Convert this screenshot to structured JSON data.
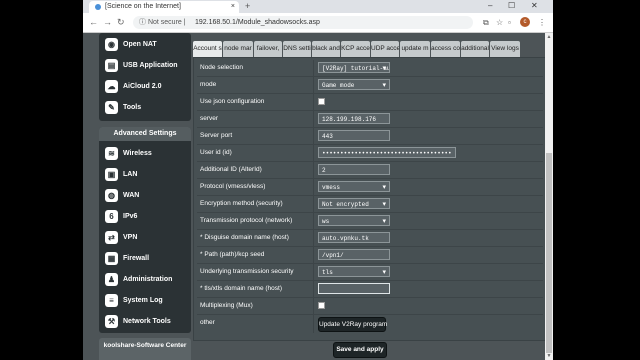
{
  "browser": {
    "tab_title": "[Science on the Internet]",
    "tab_close": "×",
    "new_tab": "+",
    "window_controls": {
      "minimize": "–",
      "maximize": "☐",
      "close": "✕"
    },
    "nav": {
      "back": "←",
      "forward": "→",
      "reload": "↻"
    },
    "not_secure": "ⓘ Not secure |",
    "url": "192.168.50.1/Module_shadowsocks.asp",
    "avatar_letter": "c",
    "menu": "⋮"
  },
  "sidebar": {
    "top_items": [
      {
        "label": "Open NAT",
        "icon": "gamepad-icon",
        "glyph": "◉"
      },
      {
        "label": "USB Application",
        "icon": "usb-icon",
        "glyph": "▤"
      },
      {
        "label": "AiCloud 2.0",
        "icon": "cloud-icon",
        "glyph": "☁"
      },
      {
        "label": "Tools",
        "icon": "wrench-icon",
        "glyph": "✎"
      }
    ],
    "advanced_heading": "Advanced Settings",
    "advanced_items": [
      {
        "label": "Wireless",
        "icon": "wireless-icon",
        "glyph": "≋"
      },
      {
        "label": "LAN",
        "icon": "lan-icon",
        "glyph": "▣"
      },
      {
        "label": "WAN",
        "icon": "globe-icon",
        "glyph": "◍"
      },
      {
        "label": "IPv6",
        "icon": "ipv6-icon",
        "glyph": "6"
      },
      {
        "label": "VPN",
        "icon": "vpn-icon",
        "glyph": "⇄"
      },
      {
        "label": "Firewall",
        "icon": "firewall-icon",
        "glyph": "▦"
      },
      {
        "label": "Administration",
        "icon": "admin-icon",
        "glyph": "♟"
      },
      {
        "label": "System Log",
        "icon": "log-icon",
        "glyph": "≡"
      },
      {
        "label": "Network Tools",
        "icon": "network-tools-icon",
        "glyph": "⚒"
      }
    ],
    "koolshare": "koolshare-Software Center"
  },
  "tabs": [
    {
      "label": "Account s"
    },
    {
      "label": "node mar"
    },
    {
      "label": "failover,"
    },
    {
      "label": "DNS setti"
    },
    {
      "label": "black and"
    },
    {
      "label": "KCP acce"
    },
    {
      "label": "UDP acce"
    },
    {
      "label": "update m"
    },
    {
      "label": "access co"
    },
    {
      "label": "additional"
    },
    {
      "label": "View logs"
    }
  ],
  "form": {
    "node_selection": {
      "label": "Node selection",
      "value": "[V2Ray] tutorial-aur"
    },
    "mode": {
      "label": "mode",
      "value": "Game mode"
    },
    "use_json": {
      "label": "Use json configuration"
    },
    "server": {
      "label": "server",
      "value": "128.199.198.176"
    },
    "server_port": {
      "label": "Server port",
      "value": "443"
    },
    "user_id": {
      "label": "User id (id)",
      "value": "••••••••••••••••••••••••••••••••••••"
    },
    "alter_id": {
      "label": "Additional ID (AlterId)",
      "value": "2"
    },
    "protocol": {
      "label": "Protocol (vmess/vless)",
      "value": "vmess"
    },
    "encryption": {
      "label": "Encryption method (security)",
      "value": "Not encrypted"
    },
    "transmission": {
      "label": "Transmission protocol (network)",
      "value": "ws"
    },
    "disguise_host": {
      "label": "* Disguise domain name (host)",
      "value": "auto.vpnku.tk"
    },
    "path": {
      "label": "* Path (path)/kcp seed",
      "value": "/vpn1/"
    },
    "transport_security": {
      "label": "Underlying transmission security",
      "value": "tls"
    },
    "tls_host": {
      "label": "* tls/xtls domain name (host)",
      "value": ""
    },
    "mux": {
      "label": "Multiplexing (Mux)"
    },
    "other": {
      "label": "other",
      "button": "Update V2Ray program"
    }
  },
  "save_button": "Save and apply"
}
